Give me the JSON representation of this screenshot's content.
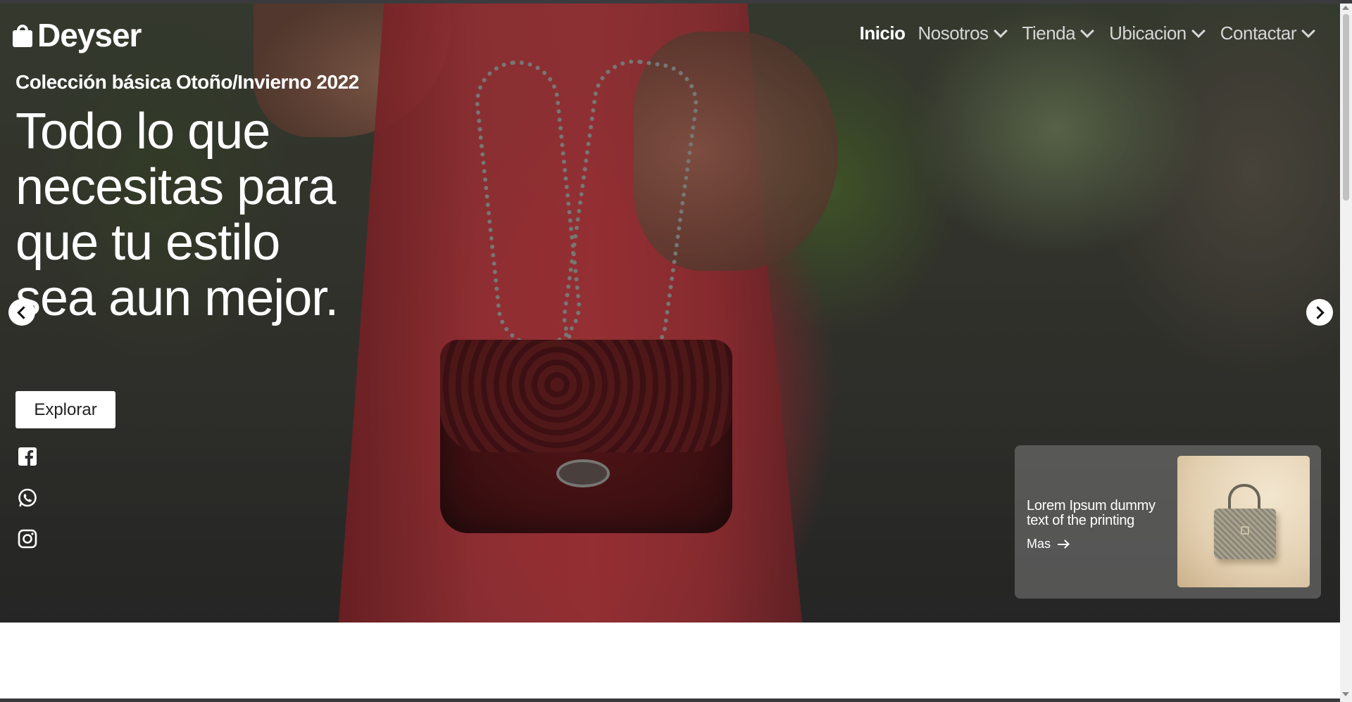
{
  "brand": {
    "name": "Deyser",
    "icon": "shopping-bag-icon"
  },
  "nav": {
    "items": [
      {
        "label": "Inicio",
        "active": true
      },
      {
        "label": "Nosotros",
        "dropdown": true
      },
      {
        "label": "Tienda",
        "dropdown": true
      },
      {
        "label": "Ubicacion",
        "dropdown": true
      },
      {
        "label": "Contactar",
        "dropdown": true
      }
    ]
  },
  "hero": {
    "kicker": "Colección básica Otoño/Invierno 2022",
    "headline": "Todo lo que necesitas para que tu estilo sea aun mejor.",
    "cta": "Explorar",
    "social": [
      "facebook-icon",
      "whatsapp-icon",
      "instagram-icon"
    ]
  },
  "card": {
    "text": "Lorem Ipsum dummy text of the printing",
    "link": "Mas",
    "image": "handbag-photo"
  },
  "colors": {
    "accent": "#ffffff",
    "dress": "#c0383e",
    "card_bg": "rgba(150,150,150,0.42)"
  }
}
